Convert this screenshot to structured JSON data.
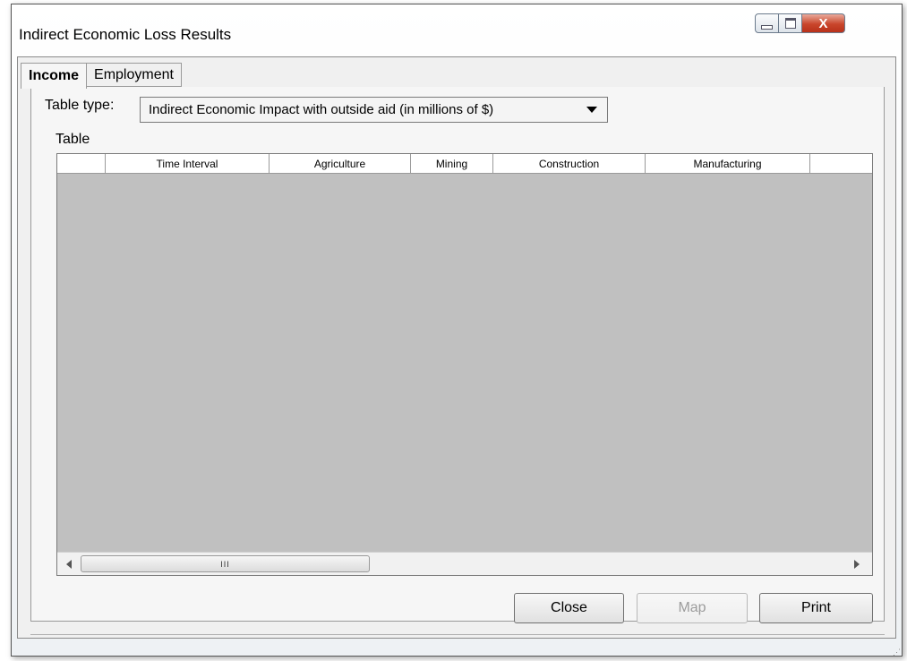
{
  "window": {
    "title": "Indirect Economic Loss Results",
    "close_glyph": "X"
  },
  "tabs": [
    {
      "label": "Income",
      "active": true
    },
    {
      "label": "Employment",
      "active": false
    }
  ],
  "table_type": {
    "label": "Table type:",
    "selected": "Indirect Economic Impact with outside aid (in millions of $)"
  },
  "table": {
    "label": "Table",
    "columns": [
      "",
      "Time Interval",
      "Agriculture",
      "Mining",
      "Construction",
      "Manufacturing",
      ""
    ],
    "rows": []
  },
  "scrollbar": {
    "thumb_grip": "III"
  },
  "buttons": {
    "close": "Close",
    "map": "Map",
    "print": "Print"
  },
  "colors": {
    "grid_empty": "#c0c0c0",
    "close_button": "#c9452b"
  }
}
